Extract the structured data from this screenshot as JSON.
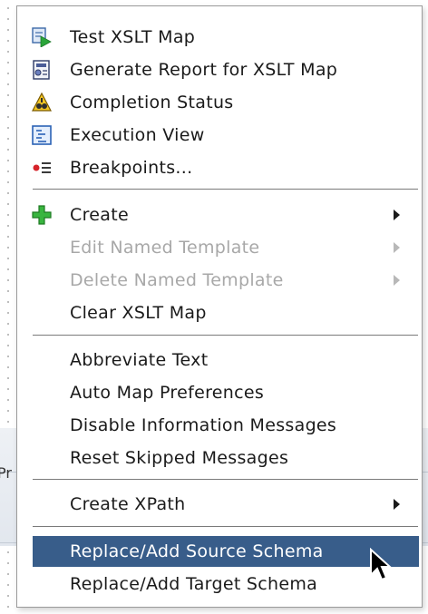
{
  "menu": {
    "items": [
      {
        "label": "Test XSLT Map",
        "icon": "test-map-icon"
      },
      {
        "label": "Generate Report for XSLT Map",
        "icon": "report-icon"
      },
      {
        "label": "Completion Status",
        "icon": "warning-icon"
      },
      {
        "label": "Execution View",
        "icon": "execution-view-icon"
      },
      {
        "label": "Breakpoints...",
        "icon": "breakpoints-icon"
      },
      {
        "label": "Create",
        "icon": "plus-icon",
        "submenu": true
      },
      {
        "label": "Edit Named Template",
        "disabled": true,
        "submenu": true
      },
      {
        "label": "Delete Named Template",
        "disabled": true,
        "submenu": true
      },
      {
        "label": "Clear XSLT Map"
      },
      {
        "label": "Abbreviate Text"
      },
      {
        "label": "Auto Map Preferences"
      },
      {
        "label": "Disable Information Messages"
      },
      {
        "label": "Reset Skipped Messages"
      },
      {
        "label": "Create XPath",
        "submenu": true
      },
      {
        "label": "Replace/Add Source Schema",
        "selected": true
      },
      {
        "label": "Replace/Add Target Schema"
      }
    ]
  },
  "background": {
    "tab_text": "Pr"
  },
  "colors": {
    "selection": "#385d8a",
    "disabled_text": "#a8a8a8",
    "separator": "#7a7a7a"
  }
}
